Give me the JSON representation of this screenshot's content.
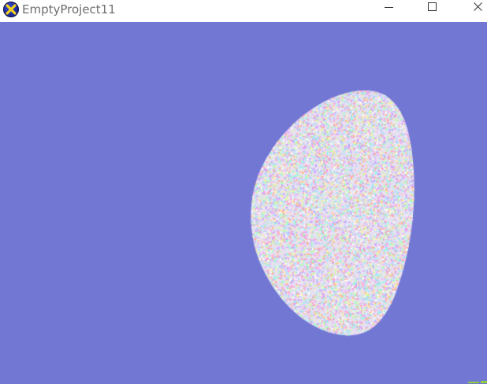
{
  "window": {
    "title": "EmptyProject11",
    "icon": "directx-x-icon",
    "controls": {
      "minimize_icon": "minimize-icon",
      "maximize_icon": "maximize-icon",
      "close_icon": "close-icon"
    }
  },
  "viewport": {
    "background_color": "#7277d4",
    "object": "noise-textured-ellipsoid"
  },
  "colors": {
    "title_text": "#6e6e6e",
    "caption_glyph": "#333333",
    "icon_x": "#f2d21b",
    "corner_mark": "#8ecf3a"
  }
}
